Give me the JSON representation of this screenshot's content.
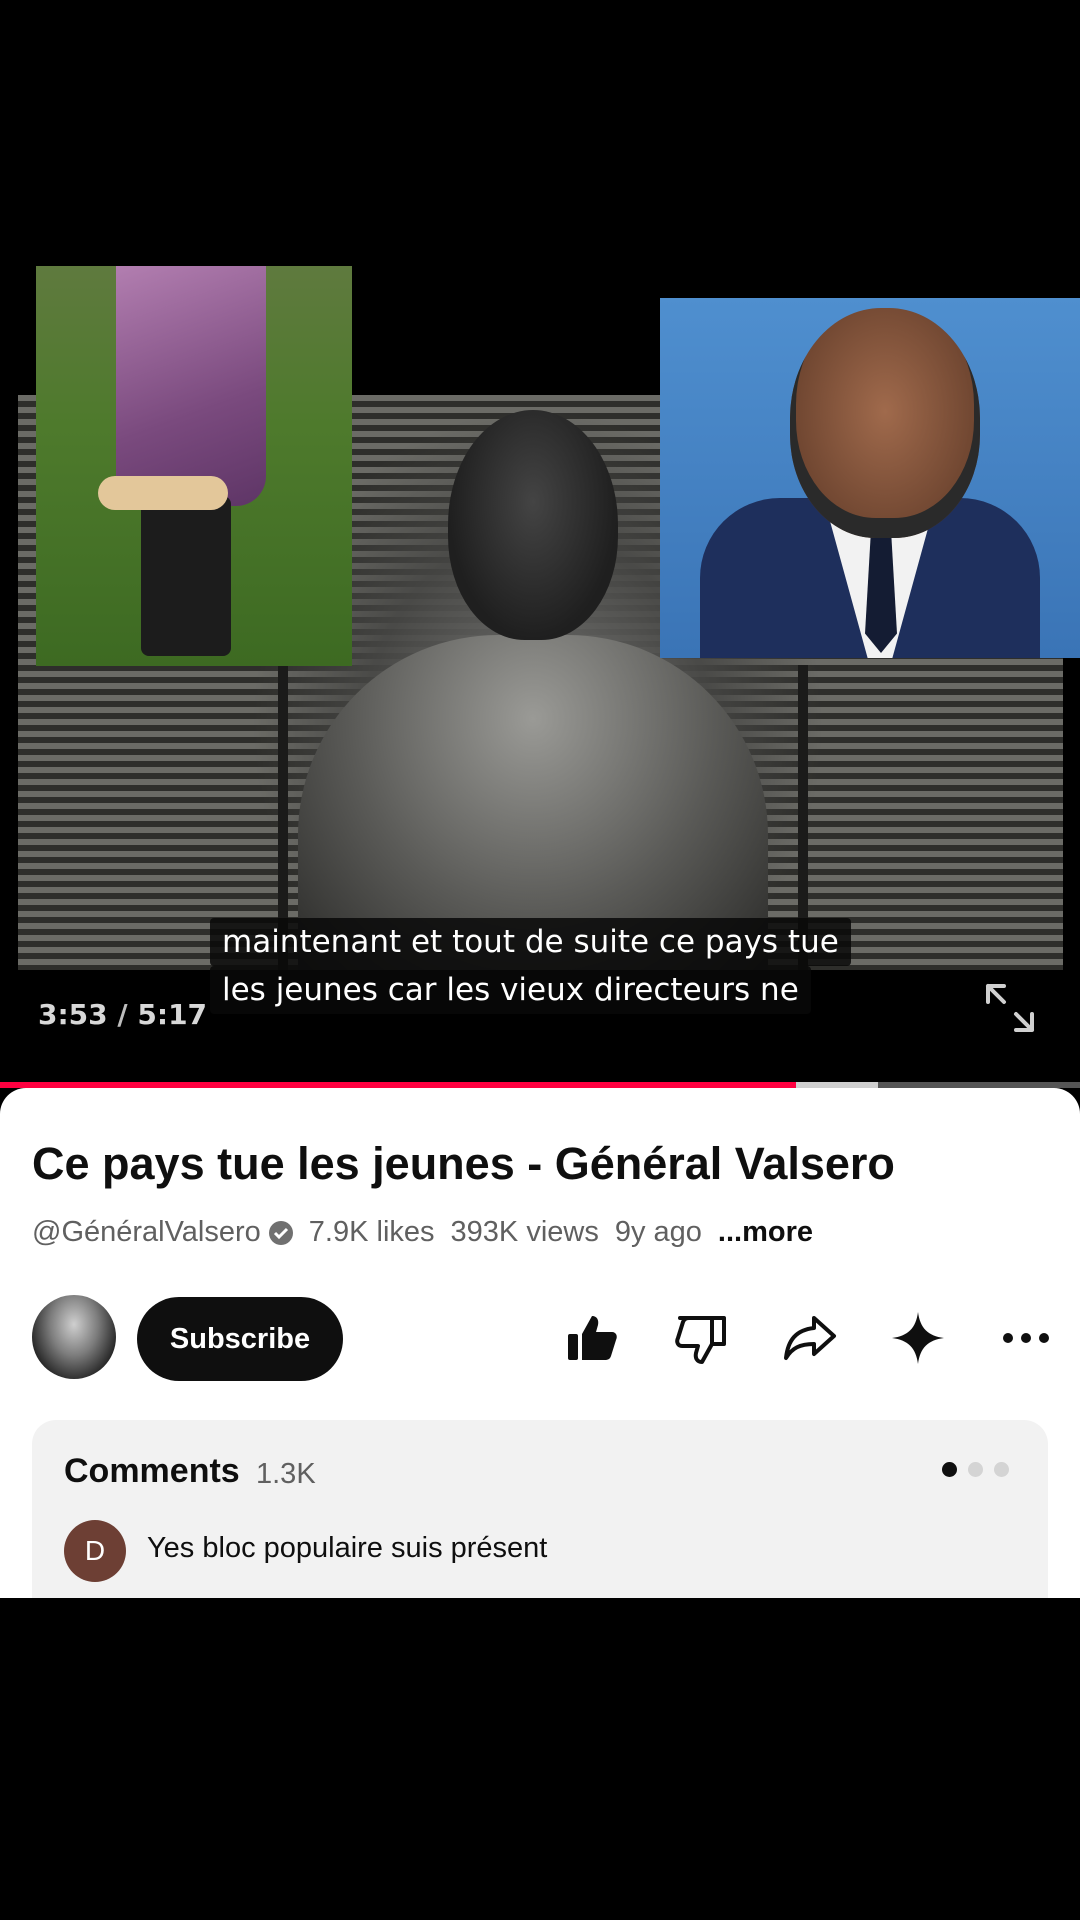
{
  "player": {
    "caption_lines": [
      "maintenant et tout de suite ce pays tue",
      "les jeunes car les vieux directeurs ne"
    ],
    "current_time": "3:53",
    "time_separator": " / ",
    "duration": "5:17",
    "progress_fraction": 0.737,
    "buffered_fraction": 0.813,
    "fullscreen_icon": "fullscreen-icon"
  },
  "video": {
    "title": "Ce pays tue les jeunes - Général Valsero",
    "channel": "@GénéralValsero",
    "likes": "7.9K likes",
    "views": "393K views",
    "age": "9y ago",
    "more": "...more"
  },
  "actions": {
    "subscribe_label": "Subscribe",
    "icons": [
      "thumbs-up-icon",
      "thumbs-down-icon",
      "share-icon",
      "remix-icon",
      "more-icon"
    ]
  },
  "comments": {
    "title": "Comments",
    "count": "1.3K",
    "top_comment": {
      "avatar_letter": "D",
      "text": "Yes bloc populaire suis présent"
    }
  },
  "colors": {
    "progress": "#ff0040",
    "sheet_bg": "#ffffff",
    "comments_bg": "#f2f2f2",
    "subscribe_bg": "#0f0f0f"
  }
}
